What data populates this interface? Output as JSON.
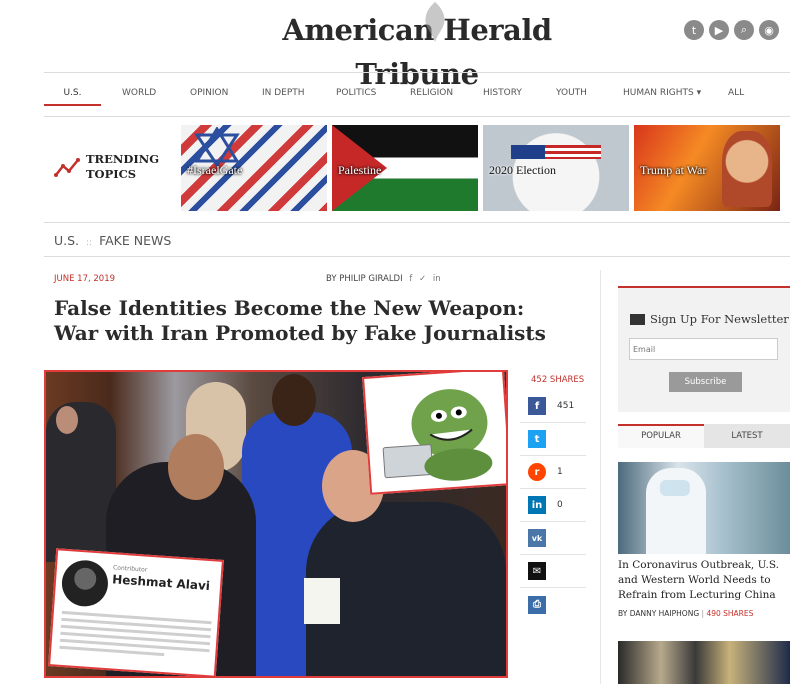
{
  "site": {
    "logo_text": "American Herald Tribune",
    "social_icons": [
      "twitter-icon",
      "youtube-icon",
      "search-icon",
      "rss-icon"
    ]
  },
  "nav": {
    "items": [
      "U.S.",
      "WORLD",
      "OPINION",
      "IN DEPTH",
      "POLITICS",
      "RELIGION",
      "HISTORY",
      "YOUTH",
      "HUMAN RIGHTS ▾",
      "ALL"
    ],
    "active": "U.S."
  },
  "trending": {
    "label_line1": "TRENDING",
    "label_line2": "TOPICS",
    "tiles": [
      "#IsraelGate",
      "Palestine",
      "2020 Election",
      "Trump at War"
    ]
  },
  "breadcrumb": {
    "section": "U.S.",
    "separator": "::",
    "category": "FAKE NEWS"
  },
  "article": {
    "date": "JUNE 17, 2019",
    "byline": "BY PHILIP GIRALDI",
    "title": "False Identities Become the New Weapon: War with Iran Promoted by Fake Journalists",
    "image_card": {
      "contributor_label": "Contributor",
      "name": "Heshmat Alavi"
    }
  },
  "shares": {
    "total_label": "452 SHARES",
    "buttons": [
      {
        "network": "facebook",
        "icon": "facebook-icon",
        "glyph": "f",
        "color": "#3b5998",
        "count": "451"
      },
      {
        "network": "twitter",
        "icon": "twitter-icon",
        "glyph": "t",
        "color": "#1da1f2",
        "count": ""
      },
      {
        "network": "reddit",
        "icon": "reddit-icon",
        "glyph": "r",
        "color": "#ff4500",
        "count": "1"
      },
      {
        "network": "linkedin",
        "icon": "linkedin-icon",
        "glyph": "in",
        "color": "#0077b5",
        "count": "0"
      },
      {
        "network": "vk",
        "icon": "vk-icon",
        "glyph": "vk",
        "color": "#4a76a8",
        "count": ""
      },
      {
        "network": "email",
        "icon": "email-icon",
        "glyph": "✉",
        "color": "#111111",
        "count": ""
      },
      {
        "network": "print",
        "icon": "print-icon",
        "glyph": "⎙",
        "color": "#3b6ea8",
        "count": ""
      }
    ]
  },
  "sidebar": {
    "newsletter_title": "Sign Up For Newsletter",
    "email_placeholder": "Email",
    "subscribe_label": "Subscribe",
    "tabs": [
      "POPULAR",
      "LATEST"
    ],
    "active_tab": "POPULAR",
    "story_title": "In Coronavirus Outbreak, U.S. and Western World Needs to Refrain from Lecturing China",
    "story_author": "BY DANNY HAIPHONG",
    "story_shares": "490 SHARES"
  },
  "colors": {
    "accent": "#c4302b",
    "hero_border": "#e03c3c"
  }
}
